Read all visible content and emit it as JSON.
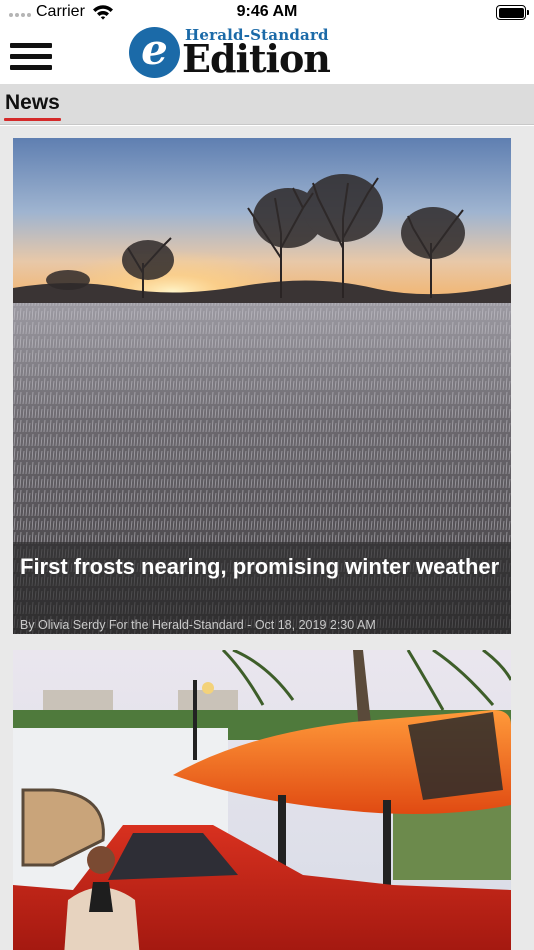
{
  "status_bar": {
    "carrier": "Carrier",
    "time": "9:46 AM"
  },
  "header": {
    "logo_letter": "e",
    "logo_top": "Herald-Standard",
    "logo_main": "Edition"
  },
  "section": {
    "active_tab": "News"
  },
  "articles": [
    {
      "headline": "First frosts nearing, promising winter weather",
      "byline": "By Olivia Serdy For the Herald-Standard - Oct 18, 2019 2:30 AM",
      "image_icon": "frosty-field-sunrise-photo"
    },
    {
      "headline": "",
      "byline": "",
      "image_icon": "red-pickup-truck-with-kayak-photo"
    }
  ],
  "colors": {
    "accent_red": "#d42a2a",
    "logo_blue": "#1b6aa8",
    "section_bar": "#dcdcdc",
    "feed_background": "#e9e9e9"
  }
}
